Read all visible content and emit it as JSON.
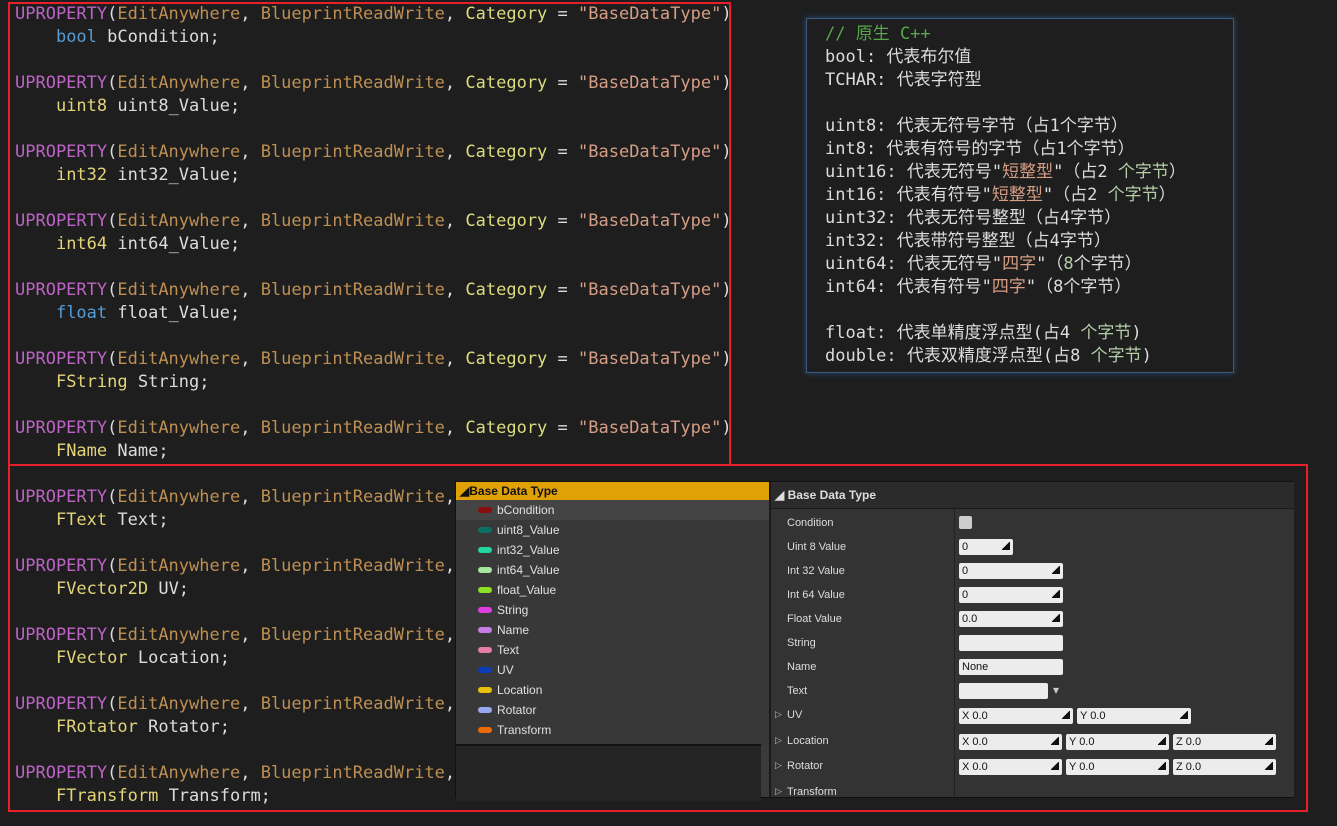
{
  "code": {
    "lines": [
      {
        "macro": "UPROPERTY",
        "spec1": "EditAnywhere",
        "spec2": "BlueprintReadWrite",
        "cat": "Category",
        "str": "\"BaseDataType\"",
        "type": "bool",
        "typeColor": "blue",
        "name": "bCondition;"
      },
      {
        "macro": "UPROPERTY",
        "spec1": "EditAnywhere",
        "spec2": "BlueprintReadWrite",
        "cat": "Category",
        "str": "\"BaseDataType\"",
        "type": "uint8",
        "typeColor": "prim",
        "name": "uint8_Value;"
      },
      {
        "macro": "UPROPERTY",
        "spec1": "EditAnywhere",
        "spec2": "BlueprintReadWrite",
        "cat": "Category",
        "str": "\"BaseDataType\"",
        "type": "int32",
        "typeColor": "prim",
        "name": "int32_Value;"
      },
      {
        "macro": "UPROPERTY",
        "spec1": "EditAnywhere",
        "spec2": "BlueprintReadWrite",
        "cat": "Category",
        "str": "\"BaseDataType\"",
        "type": "int64",
        "typeColor": "prim",
        "name": "int64_Value;"
      },
      {
        "macro": "UPROPERTY",
        "spec1": "EditAnywhere",
        "spec2": "BlueprintReadWrite",
        "cat": "Category",
        "str": "\"BaseDataType\"",
        "type": "float",
        "typeColor": "blue",
        "name": "float_Value;"
      },
      {
        "macro": "UPROPERTY",
        "spec1": "EditAnywhere",
        "spec2": "BlueprintReadWrite",
        "cat": "Category",
        "str": "\"BaseDataType\"",
        "type": "FString",
        "typeColor": "prim",
        "name": "String;"
      },
      {
        "macro": "UPROPERTY",
        "spec1": "EditAnywhere",
        "spec2": "BlueprintReadWrite",
        "cat": "Category",
        "str": "\"BaseDataType\"",
        "type": "FName",
        "typeColor": "prim",
        "name": "Name;"
      },
      {
        "macro": "UPROPERTY",
        "spec1": "EditAnywhere",
        "spec2": "BlueprintReadWrite",
        "cat": "",
        "str": "",
        "type": "FText",
        "typeColor": "prim",
        "name": "Text;"
      },
      {
        "macro": "UPROPERTY",
        "spec1": "EditAnywhere",
        "spec2": "BlueprintReadWrite",
        "cat": "",
        "str": "",
        "type": "FVector2D",
        "typeColor": "prim",
        "name": "UV;"
      },
      {
        "macro": "UPROPERTY",
        "spec1": "EditAnywhere",
        "spec2": "BlueprintReadWrite",
        "cat": "",
        "str": "",
        "type": "FVector",
        "typeColor": "prim",
        "name": "Location;"
      },
      {
        "macro": "UPROPERTY",
        "spec1": "EditAnywhere",
        "spec2": "BlueprintReadWrite",
        "cat": "",
        "str": "",
        "type": "FRotator",
        "typeColor": "prim",
        "name": "Rotator;"
      },
      {
        "macro": "UPROPERTY",
        "spec1": "EditAnywhere",
        "spec2": "BlueprintReadWrite",
        "cat": "",
        "str": "",
        "type": "FTransform",
        "typeColor": "prim",
        "name": "Transform;"
      }
    ]
  },
  "note": {
    "lines": [
      [
        {
          "t": "// 原生 C++",
          "c": "cm"
        }
      ],
      [
        {
          "t": "bool: 代表布尔值"
        }
      ],
      [
        {
          "t": "TCHAR: 代表字符型"
        }
      ],
      [],
      [
        {
          "t": "uint8: 代表无符号字节（占1个字节）"
        }
      ],
      [
        {
          "t": "int8: 代表有符号的字节（占1个字节）"
        }
      ],
      [
        {
          "t": "uint16: 代表无符号\""
        },
        {
          "t": "短整型",
          "c": "hl"
        },
        {
          "t": "\"（占2 "
        },
        {
          "t": "个字节",
          "c": "num"
        },
        {
          "t": "）"
        }
      ],
      [
        {
          "t": "int16: 代表有符号\""
        },
        {
          "t": "短整型",
          "c": "hl"
        },
        {
          "t": "\"（占2 "
        },
        {
          "t": "个字节",
          "c": "num"
        },
        {
          "t": "）"
        }
      ],
      [
        {
          "t": "uint32: 代表无符号整型（占4字节）"
        }
      ],
      [
        {
          "t": "int32: 代表带符号整型（占4字节）"
        }
      ],
      [
        {
          "t": "uint64: 代表无符号\""
        },
        {
          "t": "四字",
          "c": "hl"
        },
        {
          "t": "\"（"
        },
        {
          "t": "8",
          "c": "num"
        },
        {
          "t": "个字节）"
        }
      ],
      [
        {
          "t": "int64: 代表有符号\""
        },
        {
          "t": "四字",
          "c": "hl"
        },
        {
          "t": "\"（8个字节）"
        }
      ],
      [],
      [
        {
          "t": "float: 代表单精度浮点型(占4 "
        },
        {
          "t": "个字节",
          "c": "num"
        },
        {
          "t": ")"
        }
      ],
      [
        {
          "t": "double: 代表双精度浮点型(占8 "
        },
        {
          "t": "个字节",
          "c": "num"
        },
        {
          "t": ")"
        }
      ]
    ]
  },
  "tree": {
    "header": "Base Data Type",
    "items": [
      {
        "label": "bCondition",
        "color": "#8b0c0c"
      },
      {
        "label": "uint8_Value",
        "color": "#0b6f63"
      },
      {
        "label": "int32_Value",
        "color": "#22d6a0"
      },
      {
        "label": "int64_Value",
        "color": "#a6e6a0"
      },
      {
        "label": "float_Value",
        "color": "#8ee024"
      },
      {
        "label": "String",
        "color": "#e03ee0"
      },
      {
        "label": "Name",
        "color": "#c47ee6"
      },
      {
        "label": "Text",
        "color": "#e57ea6"
      },
      {
        "label": "UV",
        "color": "#0c3cb6"
      },
      {
        "label": "Location",
        "color": "#e8c20a"
      },
      {
        "label": "Rotator",
        "color": "#9aa8f0"
      },
      {
        "label": "Transform",
        "color": "#e86a08"
      }
    ]
  },
  "props": {
    "header": "Base Data Type",
    "rows": [
      {
        "label": "Condition",
        "kind": "checkbox"
      },
      {
        "label": "Uint 8 Value",
        "kind": "num",
        "value": "0",
        "w": 54
      },
      {
        "label": "Int 32 Value",
        "kind": "num",
        "value": "0",
        "w": 104
      },
      {
        "label": "Int 64 Value",
        "kind": "num",
        "value": "0",
        "w": 104
      },
      {
        "label": "Float Value",
        "kind": "num",
        "value": "0.0",
        "w": 104
      },
      {
        "label": "String",
        "kind": "text",
        "value": "",
        "w": 104
      },
      {
        "label": "Name",
        "kind": "text",
        "value": "None",
        "w": 104
      },
      {
        "label": "Text",
        "kind": "textdrop",
        "value": "",
        "w": 89
      },
      {
        "label": "UV",
        "kind": "vec",
        "arrow": true,
        "vals": [
          "X  0.0",
          "Y  0.0"
        ],
        "vw": 114
      },
      {
        "label": "Location",
        "kind": "vec",
        "arrow": true,
        "vals": [
          "X  0.0",
          "Y  0.0",
          "Z  0.0"
        ],
        "vw": 103
      },
      {
        "label": "Rotator",
        "kind": "vec",
        "arrow": true,
        "vals": [
          "X  0.0",
          "Y  0.0",
          "Z  0.0"
        ],
        "vw": 103
      },
      {
        "label": "Transform",
        "kind": "none",
        "arrow": true
      }
    ]
  }
}
